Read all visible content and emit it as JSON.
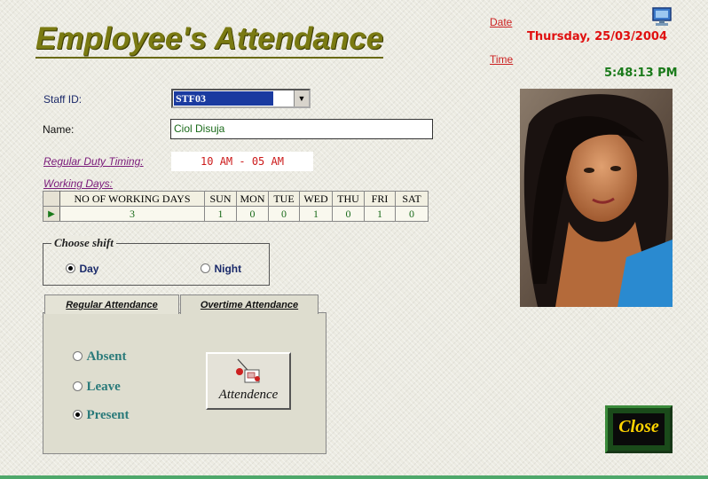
{
  "header": {
    "title": "Employee's Attendance",
    "date_label": "Date",
    "date_value": "Thursday, 25/03/2004",
    "time_label": "Time",
    "time_value": "5:48:13 PM",
    "computer_icon": "computer-monitor-icon"
  },
  "form": {
    "staff_label": "Staff ID:",
    "staff_value": "STF03",
    "name_label": "Name:",
    "name_value": "Ciol Disuja",
    "duty_label": "Regular Duty Timing:",
    "duty_value": "10 AM - 05 AM"
  },
  "working_days": {
    "label": "Working Days:",
    "columns": [
      "NO OF WORKING DAYS",
      "SUN",
      "MON",
      "TUE",
      "WED",
      "THU",
      "FRI",
      "SAT"
    ],
    "row": [
      "3",
      "1",
      "0",
      "0",
      "1",
      "0",
      "1",
      "0"
    ]
  },
  "shift": {
    "legend": "Choose shift",
    "options": [
      {
        "label": "Day",
        "selected": true
      },
      {
        "label": "Night",
        "selected": false
      }
    ]
  },
  "tabs": [
    {
      "label": "Regular Attendance",
      "active": true
    },
    {
      "label": "Overtime Attendance",
      "active": false
    }
  ],
  "attendance": {
    "options": [
      {
        "label": "Absent",
        "selected": false
      },
      {
        "label": "Leave",
        "selected": false
      },
      {
        "label": "Present",
        "selected": true
      }
    ],
    "button_label": "Attendence"
  },
  "photo": {
    "icon": "employee-photo"
  },
  "close_label": "Close",
  "colors": {
    "title": "#7a7a12",
    "date": "#e01010",
    "time": "#1a7a1a",
    "close_text": "#ffd400"
  }
}
